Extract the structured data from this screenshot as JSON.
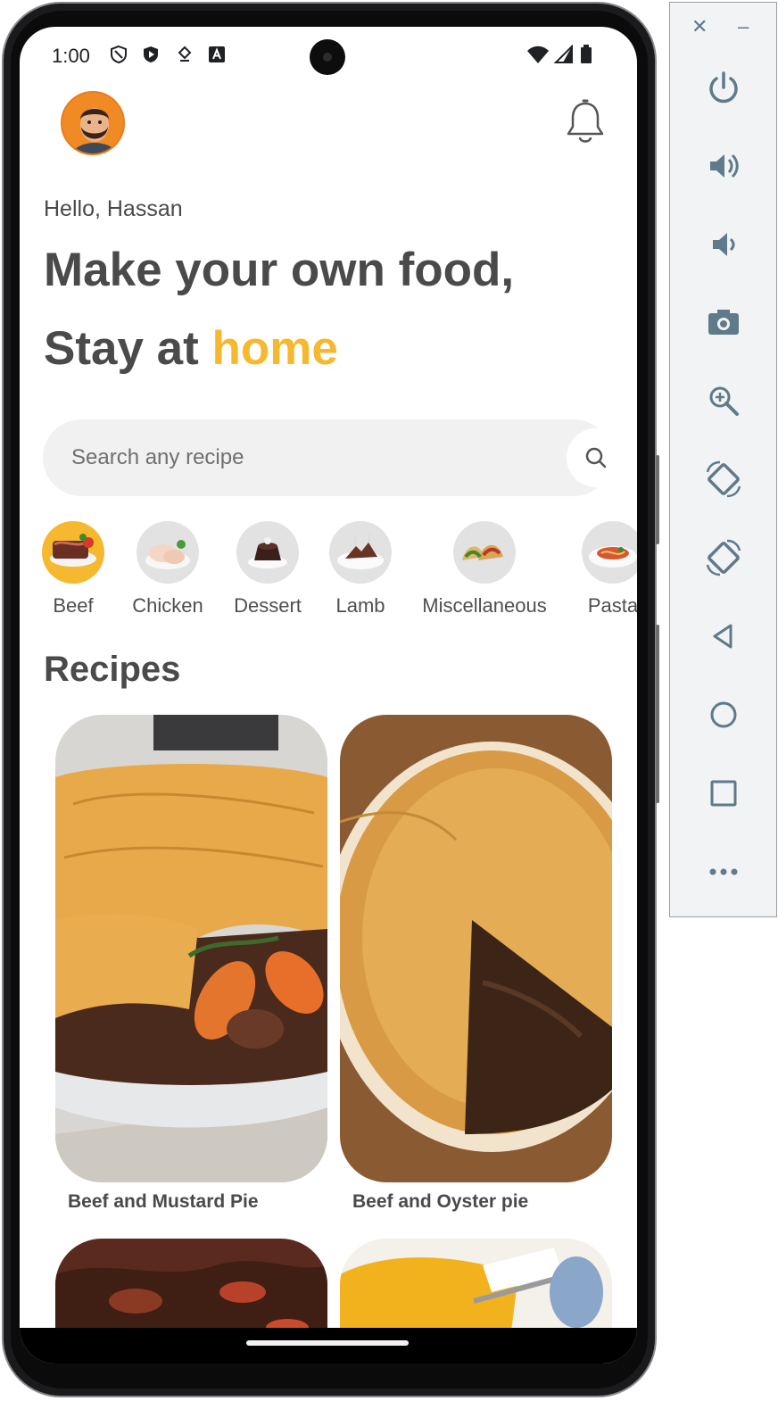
{
  "status_bar": {
    "time": "1:00"
  },
  "header": {
    "greeting": "Hello, Hassan",
    "headline_line1": "Make your own food,",
    "headline_line2_prefix": "Stay at ",
    "headline_line2_accent": "home"
  },
  "search": {
    "placeholder": "Search any recipe"
  },
  "categories": [
    {
      "label": "Beef",
      "active": true
    },
    {
      "label": "Chicken",
      "active": false
    },
    {
      "label": "Dessert",
      "active": false
    },
    {
      "label": "Lamb",
      "active": false
    },
    {
      "label": "Miscellaneous",
      "active": false
    },
    {
      "label": "Pasta",
      "active": false
    }
  ],
  "section_title": "Recipes",
  "recipes": [
    {
      "name": "Beef and Mustard Pie"
    },
    {
      "name": "Beef and Oyster pie"
    }
  ],
  "colors": {
    "accent": "#f5b82e",
    "text": "#4a4a4a",
    "search_bg": "#f1f1f1",
    "category_bg": "#e2e2e2"
  },
  "emulator_controls": [
    "close-icon",
    "minimize-icon",
    "power-icon",
    "volume-up-icon",
    "volume-down-icon",
    "camera-icon",
    "zoom-icon",
    "rotate-left-icon",
    "rotate-right-icon",
    "back-icon",
    "home-icon",
    "overview-icon",
    "more-icon"
  ]
}
